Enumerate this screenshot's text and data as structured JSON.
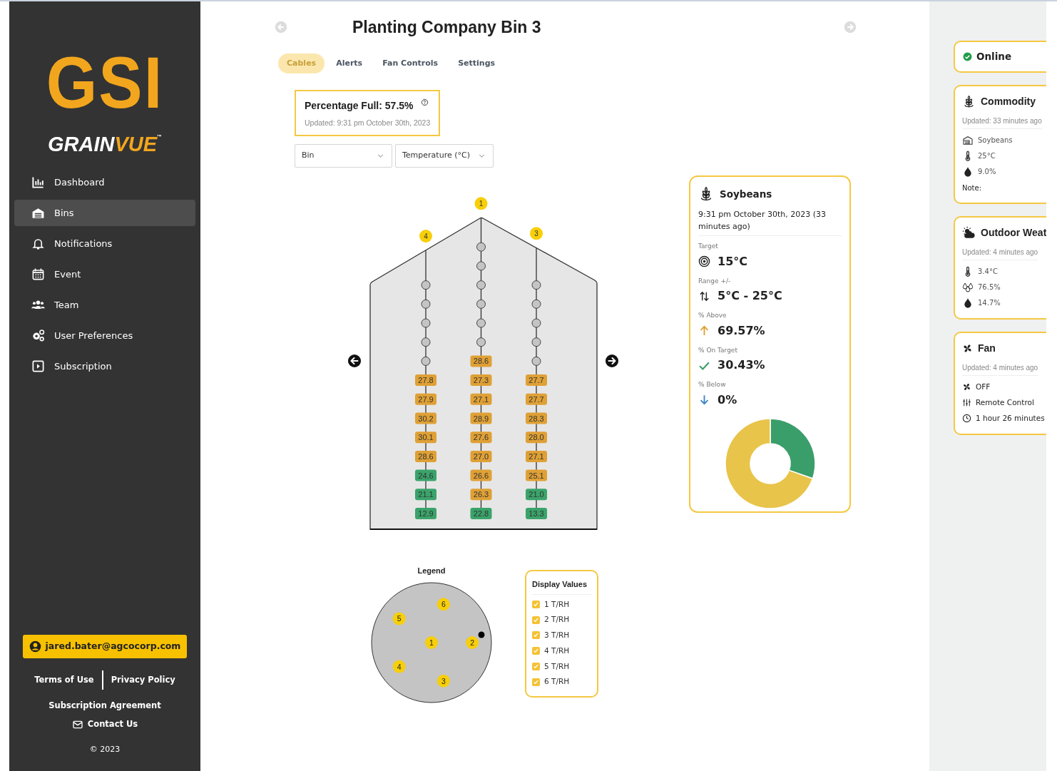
{
  "sidebar": {
    "logo": {
      "mark": "GSI",
      "word_1": "GRAIN",
      "word_2": "VUE",
      "tm": "™"
    },
    "items": [
      {
        "kind": "dashboard",
        "label": "Dashboard",
        "selected": false
      },
      {
        "kind": "bins",
        "label": "Bins",
        "selected": true
      },
      {
        "kind": "bell",
        "label": "Notifications",
        "selected": false
      },
      {
        "kind": "calendar",
        "label": "Event",
        "selected": false
      },
      {
        "kind": "team",
        "label": "Team",
        "selected": false
      },
      {
        "kind": "gears",
        "label": "User Preferences",
        "selected": false
      },
      {
        "kind": "play",
        "label": "Subscription",
        "selected": false
      }
    ],
    "account": "jared.bater@agcocorp.com",
    "links": [
      "Terms of Use",
      "Privacy Policy"
    ],
    "agreement": "Subscription Agreement",
    "contact": "Contact Us",
    "copyright": "© 2023"
  },
  "header": {
    "title": "Planting Company Bin 3"
  },
  "tabs": [
    {
      "label": "Cables",
      "selected": true
    },
    {
      "label": "Alerts",
      "selected": false
    },
    {
      "label": "Fan Controls",
      "selected": false
    },
    {
      "label": "Settings",
      "selected": false
    }
  ],
  "fill_card": {
    "title": "Percentage Full: 57.5%",
    "updated": "Updated: 9:31 pm October 30th, 2023"
  },
  "dropdowns": [
    {
      "value": "Bin"
    },
    {
      "value": "Temperature (°C)"
    }
  ],
  "cables": [
    {
      "number": "4",
      "sensors": [
        {
          "kind": "empty"
        },
        {
          "kind": "empty"
        },
        {
          "kind": "empty"
        },
        {
          "kind": "empty"
        },
        {
          "kind": "empty"
        },
        {
          "kind": "reading",
          "value": "27.8",
          "color": "#dfa035"
        },
        {
          "kind": "reading",
          "value": "27.9",
          "color": "#dfa035"
        },
        {
          "kind": "reading",
          "value": "30.2",
          "color": "#dfa035"
        },
        {
          "kind": "reading",
          "value": "30.1",
          "color": "#dfa035"
        },
        {
          "kind": "reading",
          "value": "28.6",
          "color": "#dfa035"
        },
        {
          "kind": "reading",
          "value": "24.6",
          "color": "#3aa36a"
        },
        {
          "kind": "reading",
          "value": "21.1",
          "color": "#3aa36a"
        },
        {
          "kind": "reading",
          "value": "12.9",
          "color": "#3aa36a"
        }
      ]
    },
    {
      "number": "1",
      "sensors": [
        {
          "kind": "empty"
        },
        {
          "kind": "empty"
        },
        {
          "kind": "empty"
        },
        {
          "kind": "empty"
        },
        {
          "kind": "empty"
        },
        {
          "kind": "empty"
        },
        {
          "kind": "reading",
          "value": "28.6",
          "color": "#dfa035"
        },
        {
          "kind": "reading",
          "value": "27.3",
          "color": "#dfa035"
        },
        {
          "kind": "reading",
          "value": "27.1",
          "color": "#dfa035"
        },
        {
          "kind": "reading",
          "value": "28.9",
          "color": "#dfa035"
        },
        {
          "kind": "reading",
          "value": "27.6",
          "color": "#dfa035"
        },
        {
          "kind": "reading",
          "value": "27.0",
          "color": "#dfa035"
        },
        {
          "kind": "reading",
          "value": "26.6",
          "color": "#dfa035"
        },
        {
          "kind": "reading",
          "value": "26.3",
          "color": "#dfa035"
        },
        {
          "kind": "reading",
          "value": "22.8",
          "color": "#3aa36a"
        }
      ]
    },
    {
      "number": "3",
      "sensors": [
        {
          "kind": "empty"
        },
        {
          "kind": "empty"
        },
        {
          "kind": "empty"
        },
        {
          "kind": "empty"
        },
        {
          "kind": "empty"
        },
        {
          "kind": "reading",
          "value": "27.7",
          "color": "#dfa035"
        },
        {
          "kind": "reading",
          "value": "27.7",
          "color": "#dfa035"
        },
        {
          "kind": "reading",
          "value": "28.3",
          "color": "#dfa035"
        },
        {
          "kind": "reading",
          "value": "28.0",
          "color": "#dfa035"
        },
        {
          "kind": "reading",
          "value": "27.1",
          "color": "#dfa035"
        },
        {
          "kind": "reading",
          "value": "25.1",
          "color": "#dfa035"
        },
        {
          "kind": "reading",
          "value": "21.0",
          "color": "#3aa36a"
        },
        {
          "kind": "reading",
          "value": "13.3",
          "color": "#3aa36a"
        }
      ]
    }
  ],
  "legend": {
    "title": "Legend",
    "markers": [
      {
        "number": "6"
      },
      {
        "number": "5"
      },
      {
        "number": "1"
      },
      {
        "number": "2"
      },
      {
        "number": "4"
      },
      {
        "number": "3"
      }
    ]
  },
  "display_values": {
    "title": "Display Values",
    "options": [
      {
        "label": "1 T/RH",
        "checked": true
      },
      {
        "label": "2 T/RH",
        "checked": true
      },
      {
        "label": "3 T/RH",
        "checked": true
      },
      {
        "label": "4 T/RH",
        "checked": true
      },
      {
        "label": "5 T/RH",
        "checked": true
      },
      {
        "label": "6 T/RH",
        "checked": true
      }
    ]
  },
  "summary": {
    "title": "Soybeans",
    "time": "9:31 pm October 30th, 2023 (33 minutes ago)",
    "metrics": [
      {
        "kind": "target",
        "label": "Target",
        "value": "15°C"
      },
      {
        "kind": "range",
        "label": "Range +/-",
        "value": "5°C - 25°C"
      },
      {
        "kind": "above",
        "label": "% Above",
        "value": "69.57%"
      },
      {
        "kind": "on_target",
        "label": "% On Target",
        "value": "30.43%"
      },
      {
        "kind": "below",
        "label": "% Below",
        "value": "0%"
      }
    ],
    "chart_data": {
      "type": "donut",
      "values": [
        30.43,
        69.57
      ]
    }
  },
  "status": {
    "label": "Online"
  },
  "info_cards": [
    {
      "kind": "commodity",
      "title": "Commodity",
      "updated": "Updated: 33 minutes ago",
      "rows": [
        {
          "kind": "bin",
          "text": "Soybeans"
        },
        {
          "kind": "thermometer",
          "text": "25°C"
        },
        {
          "kind": "drop",
          "text": "9.0%"
        }
      ],
      "note": "Note:"
    },
    {
      "kind": "weather",
      "title": "Outdoor Weat",
      "updated": "Updated: 4 minutes ago",
      "rows": [
        {
          "kind": "thermometer",
          "text": "3.4°C"
        },
        {
          "kind": "humidity",
          "text": "76.5%"
        },
        {
          "kind": "drop",
          "text": "14.7%"
        }
      ]
    },
    {
      "kind": "fan",
      "title": "Fan",
      "updated": "Updated: 4 minutes ago",
      "rows": [
        {
          "kind": "fan",
          "text": "OFF"
        },
        {
          "kind": "sliders",
          "text": "Remote Control"
        },
        {
          "kind": "clock",
          "text": "1 hour 26 minutes"
        }
      ]
    }
  ]
}
